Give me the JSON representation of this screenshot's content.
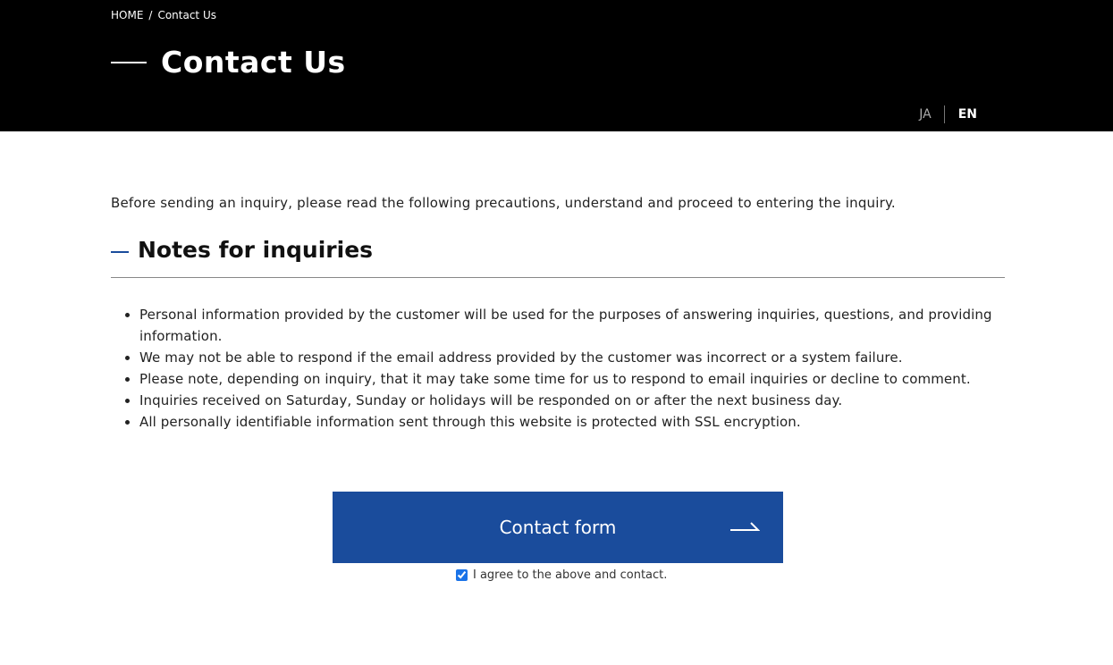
{
  "breadcrumb": {
    "home": "HOME",
    "separator": "/",
    "current": "Contact Us"
  },
  "hero": {
    "title": "Contact Us"
  },
  "language": {
    "ja": "JA",
    "en": "EN",
    "active": "EN"
  },
  "intro": "Before sending an inquiry, please read the following precautions, understand and proceed to entering the inquiry.",
  "notes": {
    "title": "Notes for inquiries",
    "items": [
      "Personal information provided by the customer will be used for the purposes of answering inquiries, questions, and providing information.",
      "We may not be able to respond if the email address provided by the customer was incorrect or a system failure.",
      "Please note, depending on inquiry, that it may take some time for us to respond to email inquiries or decline to comment.",
      "Inquiries received on Saturday, Sunday or holidays will be responded on or after the next business day.",
      "All personally identifiable information sent through this website is protected with SSL encryption."
    ]
  },
  "cta": {
    "label": "Contact form",
    "icon": "arrow-right-icon"
  },
  "agree": {
    "label": "I agree to the above and contact.",
    "checked": true
  },
  "colors": {
    "hero_bg": "#000000",
    "accent": "#1a4c9c",
    "text": "#222222"
  }
}
